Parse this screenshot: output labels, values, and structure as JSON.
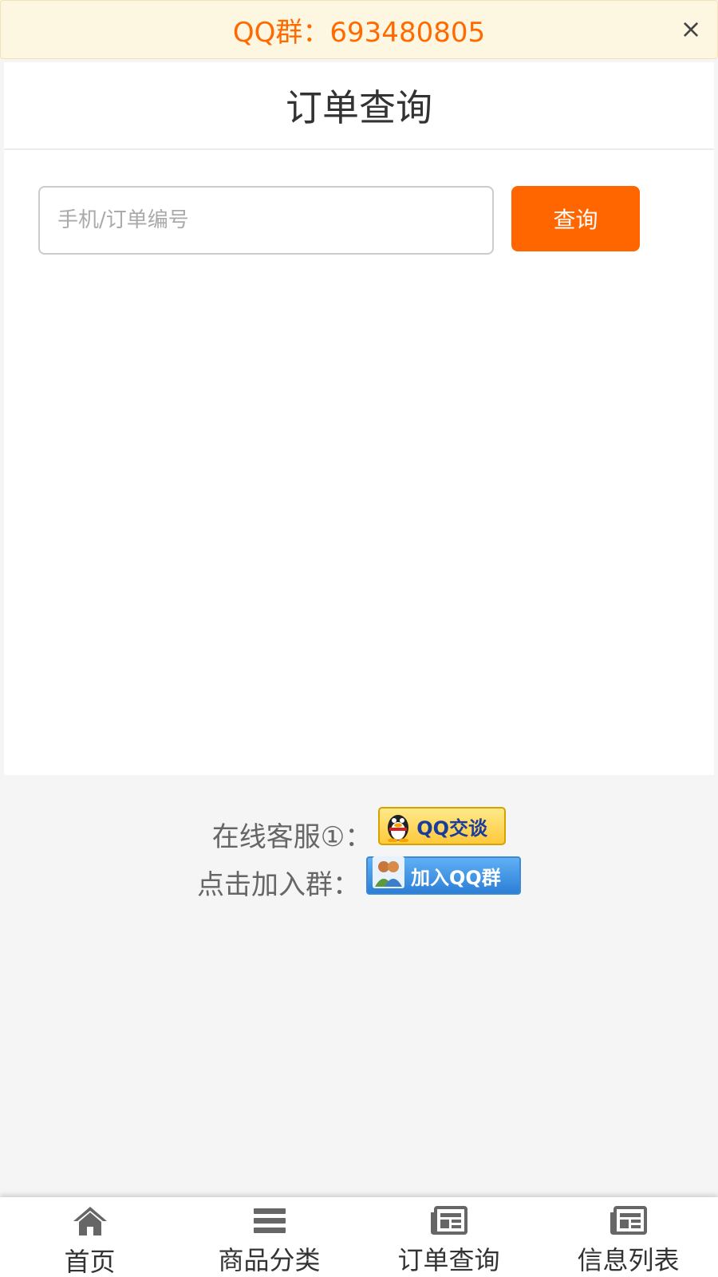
{
  "notice": {
    "text": "QQ群：693480805",
    "close_label": "×"
  },
  "page": {
    "title": "订单查询"
  },
  "search": {
    "placeholder": "手机/订单编号",
    "value": "",
    "button_label": "查询"
  },
  "contact": {
    "service_label": "在线客服①：",
    "service_button_text": "QQ交谈",
    "group_label": "点击加入群：",
    "group_button_text": "加入QQ群"
  },
  "tabbar": {
    "items": [
      {
        "label": "首页",
        "icon": "home-icon"
      },
      {
        "label": "商品分类",
        "icon": "menu-icon"
      },
      {
        "label": "订单查询",
        "icon": "news-icon"
      },
      {
        "label": "信息列表",
        "icon": "news-icon"
      }
    ]
  },
  "colors": {
    "accent": "#ff6600",
    "notice_bg": "#fdf6e1",
    "page_bg": "#f5f5f5"
  }
}
